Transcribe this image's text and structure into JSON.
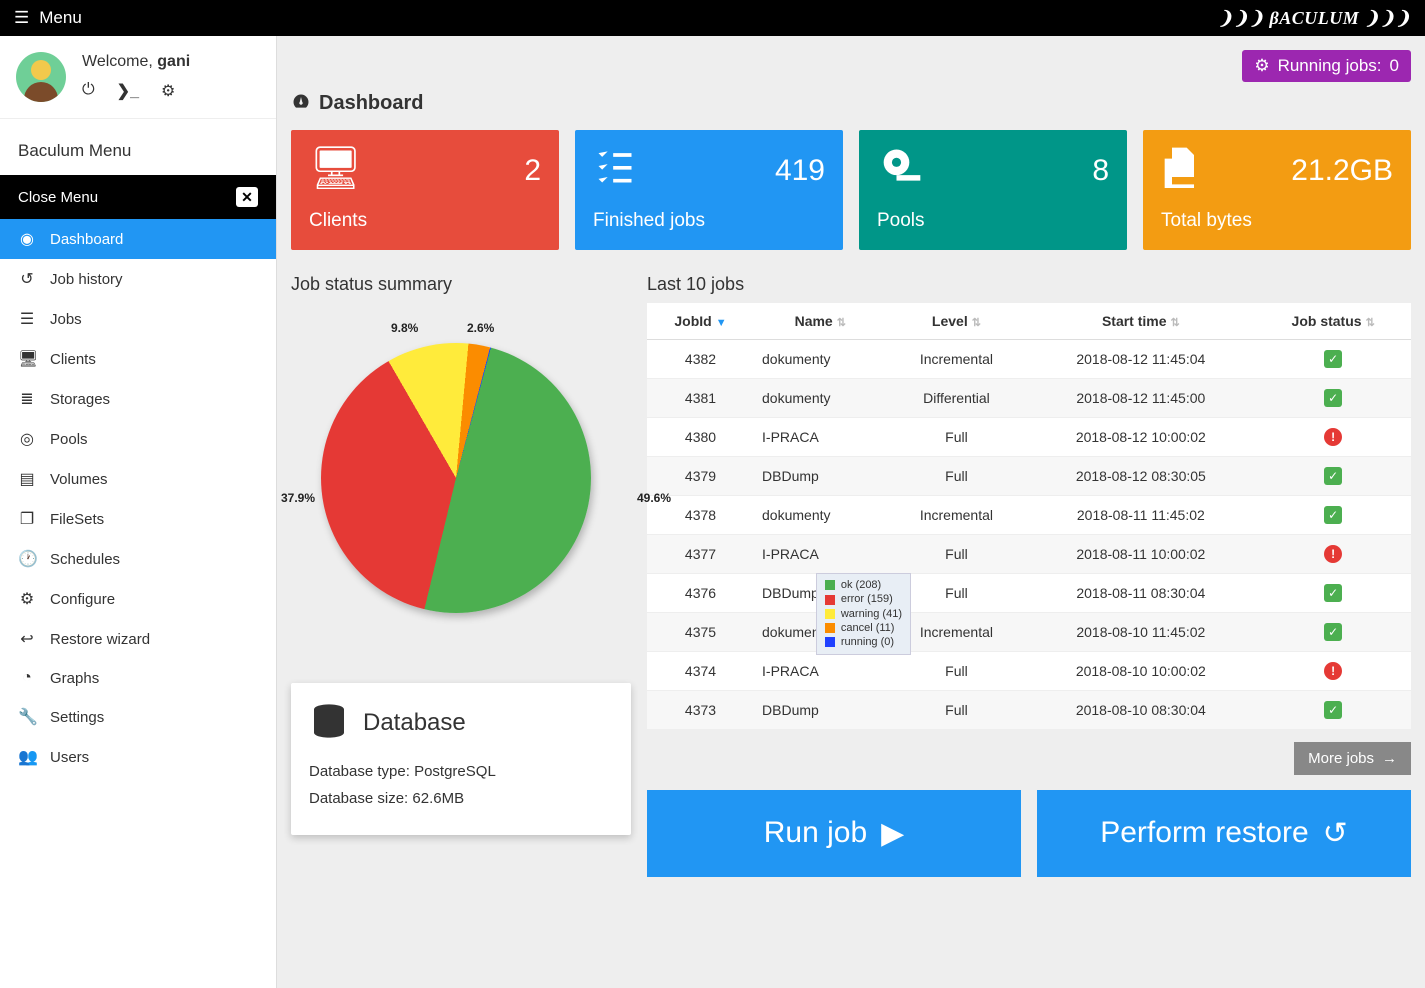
{
  "topbar": {
    "menu": "Menu",
    "brand": "❩❩❩ βACULUM ❩❩❩"
  },
  "user": {
    "welcome_prefix": "Welcome, ",
    "name": "gani"
  },
  "running_jobs": {
    "label": "Running jobs:",
    "count": "0"
  },
  "menu": {
    "title": "Baculum Menu",
    "close": "Close Menu",
    "items": [
      {
        "icon": "dashboard",
        "label": "Dashboard",
        "active": true
      },
      {
        "icon": "history",
        "label": "Job history"
      },
      {
        "icon": "list",
        "label": "Jobs"
      },
      {
        "icon": "monitor",
        "label": "Clients"
      },
      {
        "icon": "database",
        "label": "Storages"
      },
      {
        "icon": "tape",
        "label": "Pools"
      },
      {
        "icon": "hdd",
        "label": "Volumes"
      },
      {
        "icon": "files",
        "label": "FileSets"
      },
      {
        "icon": "clock",
        "label": "Schedules"
      },
      {
        "icon": "gear",
        "label": "Configure"
      },
      {
        "icon": "undo",
        "label": "Restore wizard"
      },
      {
        "icon": "chart",
        "label": "Graphs"
      },
      {
        "icon": "wrench",
        "label": "Settings"
      },
      {
        "icon": "users",
        "label": "Users"
      }
    ]
  },
  "page": {
    "title": "Dashboard"
  },
  "cards": {
    "clients": {
      "value": "2",
      "label": "Clients"
    },
    "finished": {
      "value": "419",
      "label": "Finished jobs"
    },
    "pools": {
      "value": "8",
      "label": "Pools"
    },
    "bytes": {
      "value": "21.2GB",
      "label": "Total bytes"
    }
  },
  "chart_data": {
    "type": "pie",
    "title": "Job status summary",
    "series": [
      {
        "name": "ok",
        "count": 208,
        "percent": 49.6,
        "color": "#4CAF50"
      },
      {
        "name": "error",
        "count": 159,
        "percent": 37.9,
        "color": "#E53935"
      },
      {
        "name": "warning",
        "count": 41,
        "percent": 9.8,
        "color": "#FFEB3B"
      },
      {
        "name": "cancel",
        "count": 11,
        "percent": 2.6,
        "color": "#FB8C00"
      },
      {
        "name": "running",
        "count": 0,
        "percent": 0.0,
        "color": "#1E40FF"
      }
    ],
    "legend": [
      "ok (208)",
      "error (159)",
      "warning (41)",
      "cancel (11)",
      "running (0)"
    ],
    "labels": [
      "49.6%",
      "37.9%",
      "9.8%",
      "2.6%"
    ]
  },
  "jobs_table": {
    "title": "Last 10 jobs",
    "headers": {
      "jobid": "JobId",
      "name": "Name",
      "level": "Level",
      "start": "Start time",
      "status": "Job status"
    },
    "rows": [
      {
        "jobid": "4382",
        "name": "dokumenty",
        "level": "Incremental",
        "start": "2018-08-12 11:45:04",
        "status": "ok"
      },
      {
        "jobid": "4381",
        "name": "dokumenty",
        "level": "Differential",
        "start": "2018-08-12 11:45:00",
        "status": "ok"
      },
      {
        "jobid": "4380",
        "name": "I-PRACA",
        "level": "Full",
        "start": "2018-08-12 10:00:02",
        "status": "error"
      },
      {
        "jobid": "4379",
        "name": "DBDump",
        "level": "Full",
        "start": "2018-08-12 08:30:05",
        "status": "ok"
      },
      {
        "jobid": "4378",
        "name": "dokumenty",
        "level": "Incremental",
        "start": "2018-08-11 11:45:02",
        "status": "ok"
      },
      {
        "jobid": "4377",
        "name": "I-PRACA",
        "level": "Full",
        "start": "2018-08-11 10:00:02",
        "status": "error"
      },
      {
        "jobid": "4376",
        "name": "DBDump",
        "level": "Full",
        "start": "2018-08-11 08:30:04",
        "status": "ok"
      },
      {
        "jobid": "4375",
        "name": "dokumenty",
        "level": "Incremental",
        "start": "2018-08-10 11:45:02",
        "status": "ok"
      },
      {
        "jobid": "4374",
        "name": "I-PRACA",
        "level": "Full",
        "start": "2018-08-10 10:00:02",
        "status": "error"
      },
      {
        "jobid": "4373",
        "name": "DBDump",
        "level": "Full",
        "start": "2018-08-10 08:30:04",
        "status": "ok"
      }
    ]
  },
  "database": {
    "title": "Database",
    "type_label": "Database type:",
    "type_value": "PostgreSQL",
    "size_label": "Database size:",
    "size_value": "62.6MB"
  },
  "buttons": {
    "more_jobs": "More jobs",
    "run_job": "Run job",
    "perform_restore": "Perform restore"
  }
}
